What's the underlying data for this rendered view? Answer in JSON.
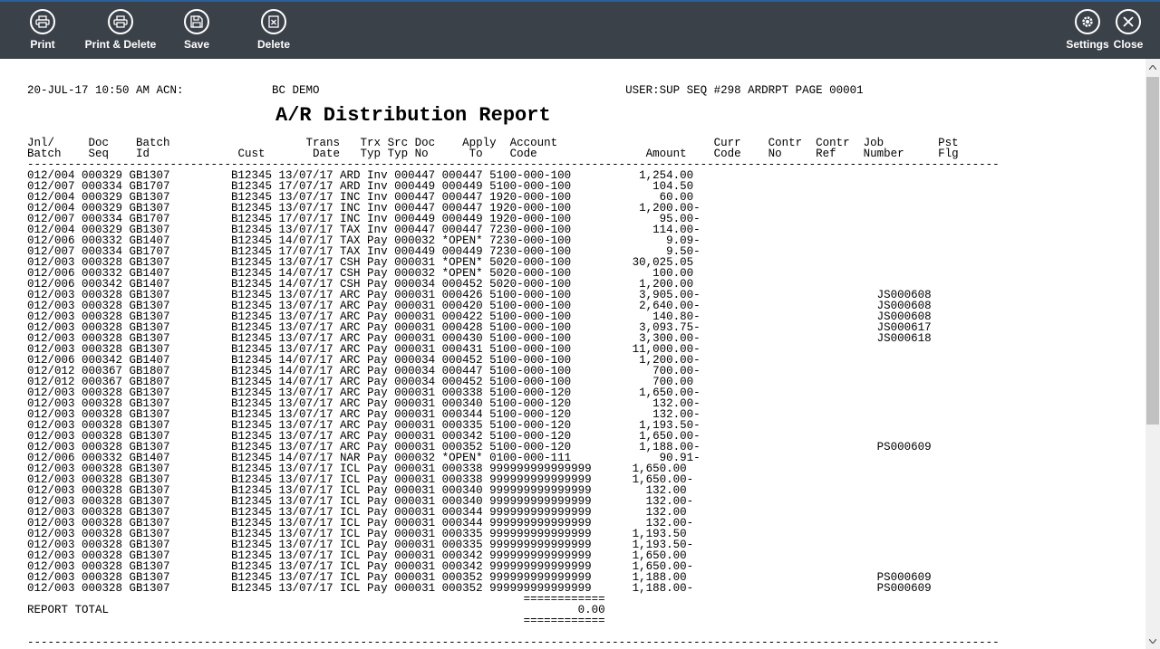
{
  "toolbar": {
    "print_label": "Print",
    "print_delete_label": "Print & Delete",
    "save_label": "Save",
    "delete_label": "Delete",
    "settings_label": "Settings",
    "close_label": "Close",
    "icons": [
      "printer-icon",
      "printer-icon",
      "save-icon",
      "delete-icon",
      "gear-icon",
      "close-icon"
    ]
  },
  "report": {
    "header_line": "20-JUL-17 10:50 AM ACN:             BC DEMO                                             USER:SUP SEQ #298 ARDRPT PAGE 00001",
    "title": "A/R Distribution Report",
    "column_header_1": "Jnl/     Doc    Batch                    Trans   Trx Src Doc    Apply  Account                       Curr    Contr  Contr  Job        Pst",
    "column_header_2": "Batch    Seq    Id             Cust       Date   Typ Typ No      To    Code                Amount    Code    No     Ref    Number     Flg",
    "separator": "-----------------------------------------------------------------------------------------------------------------------------------------------",
    "rows": [
      "012/004 000329 GB1307         B12345 13/07/17 ARD Inv 000447 000447 5100-000-100          1,254.00",
      "012/007 000334 GB1707         B12345 17/07/17 ARD Inv 000449 000449 5100-000-100            104.50",
      "012/004 000329 GB1307         B12345 13/07/17 INC Inv 000447 000447 1920-000-100             60.00",
      "012/004 000329 GB1307         B12345 13/07/17 INC Inv 000447 000447 1920-000-100          1,200.00-",
      "012/007 000334 GB1707         B12345 17/07/17 INC Inv 000449 000449 1920-000-100             95.00-",
      "012/004 000329 GB1307         B12345 13/07/17 TAX Inv 000447 000447 7230-000-100            114.00-",
      "012/006 000332 GB1407         B12345 14/07/17 TAX Pay 000032 *OPEN* 7230-000-100              9.09-",
      "012/007 000334 GB1707         B12345 17/07/17 TAX Inv 000449 000449 7230-000-100              9.50-",
      "012/003 000328 GB1307         B12345 13/07/17 CSH Pay 000031 *OPEN* 5020-000-100         30,025.05",
      "012/006 000332 GB1407         B12345 14/07/17 CSH Pay 000032 *OPEN* 5020-000-100            100.00",
      "012/006 000342 GB1407         B12345 14/07/17 CSH Pay 000034 000452 5020-000-100          1,200.00",
      "012/003 000328 GB1307         B12345 13/07/17 ARC Pay 000031 000426 5100-000-100          3,905.00-                          JS000608",
      "012/003 000328 GB1307         B12345 13/07/17 ARC Pay 000031 000420 5100-000-100          2,640.00-                          JS000608",
      "012/003 000328 GB1307         B12345 13/07/17 ARC Pay 000031 000422 5100-000-100            140.80-                          JS000608",
      "012/003 000328 GB1307         B12345 13/07/17 ARC Pay 000031 000428 5100-000-100          3,093.75-                          JS000617",
      "012/003 000328 GB1307         B12345 13/07/17 ARC Pay 000031 000430 5100-000-100          3,300.00-                          JS000618",
      "012/003 000328 GB1307         B12345 13/07/17 ARC Pay 000031 000431 5100-000-100         11,000.00-",
      "012/006 000342 GB1407         B12345 14/07/17 ARC Pay 000034 000452 5100-000-100          1,200.00-",
      "012/012 000367 GB1807         B12345 14/07/17 ARC Pay 000034 000447 5100-000-100            700.00-",
      "012/012 000367 GB1807         B12345 14/07/17 ARC Pay 000034 000452 5100-000-100            700.00",
      "012/003 000328 GB1307         B12345 13/07/17 ARC Pay 000031 000338 5100-000-120          1,650.00-",
      "012/003 000328 GB1307         B12345 13/07/17 ARC Pay 000031 000340 5100-000-120            132.00-",
      "012/003 000328 GB1307         B12345 13/07/17 ARC Pay 000031 000344 5100-000-120            132.00-",
      "012/003 000328 GB1307         B12345 13/07/17 ARC Pay 000031 000335 5100-000-120          1,193.50-",
      "012/003 000328 GB1307         B12345 13/07/17 ARC Pay 000031 000342 5100-000-120          1,650.00-",
      "012/003 000328 GB1307         B12345 13/07/17 ARC Pay 000031 000352 5100-000-120          1,188.00-                          PS000609",
      "012/006 000332 GB1407         B12345 14/07/17 NAR Pay 000032 *OPEN* 0100-000-111             90.91-",
      "012/003 000328 GB1307         B12345 13/07/17 ICL Pay 000031 000338 999999999999999      1,650.00",
      "012/003 000328 GB1307         B12345 13/07/17 ICL Pay 000031 000338 999999999999999      1,650.00-",
      "012/003 000328 GB1307         B12345 13/07/17 ICL Pay 000031 000340 999999999999999        132.00",
      "012/003 000328 GB1307         B12345 13/07/17 ICL Pay 000031 000340 999999999999999        132.00-",
      "012/003 000328 GB1307         B12345 13/07/17 ICL Pay 000031 000344 999999999999999        132.00",
      "012/003 000328 GB1307         B12345 13/07/17 ICL Pay 000031 000344 999999999999999        132.00-",
      "012/003 000328 GB1307         B12345 13/07/17 ICL Pay 000031 000335 999999999999999      1,193.50",
      "012/003 000328 GB1307         B12345 13/07/17 ICL Pay 000031 000335 999999999999999      1,193.50-",
      "012/003 000328 GB1307         B12345 13/07/17 ICL Pay 000031 000342 999999999999999      1,650.00",
      "012/003 000328 GB1307         B12345 13/07/17 ICL Pay 000031 000342 999999999999999      1,650.00-",
      "012/003 000328 GB1307         B12345 13/07/17 ICL Pay 000031 000352 999999999999999      1,188.00                            PS000609",
      "012/003 000328 GB1307         B12345 13/07/17 ICL Pay 000031 000352 999999999999999      1,188.00-                           PS000609"
    ],
    "total_rule": "                                                                         ============",
    "total_line": "REPORT TOTAL                                                                     0.00",
    "total_rule_bottom": "                                                                         ============",
    "footer_rule": "-----------------------------------------------------------------------------------------------------------------------------------------------"
  },
  "colors": {
    "toolbar_bg": "#3b4149",
    "toolbar_accent": "#2a5f9a",
    "scrollbar_thumb": "#c1c1c1"
  }
}
